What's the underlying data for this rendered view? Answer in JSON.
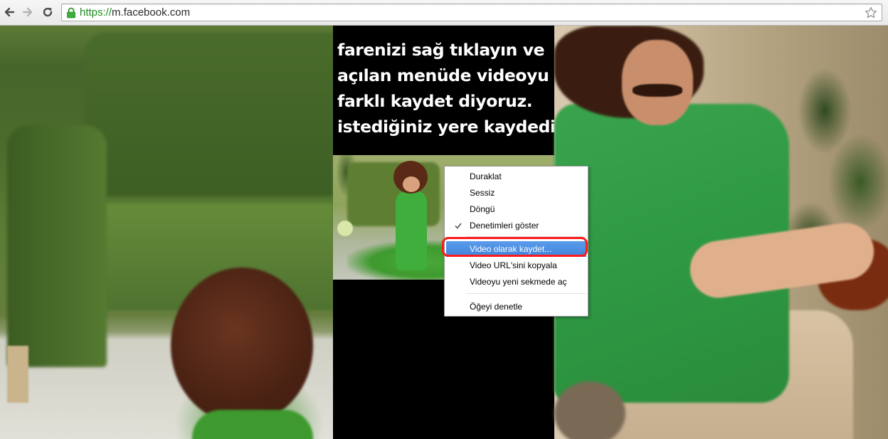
{
  "browser": {
    "url_scheme": "https://",
    "url_host": "m.facebook.com",
    "back_icon": "back-arrow-icon",
    "forward_icon": "forward-arrow-icon",
    "reload_icon": "reload-icon",
    "lock_icon": "lock-icon",
    "bookmark_icon": "star-icon",
    "secure_color": "#1c8c1c"
  },
  "page": {
    "caption_lines": [
      "farenizi sağ tıklayın ve",
      "açılan menüde videoyu",
      "farklı kaydet diyoruz.",
      "istediğiniz yere kaydedin"
    ]
  },
  "context_menu": {
    "items": [
      {
        "label": "Duraklat",
        "checked": false,
        "highlighted": false
      },
      {
        "label": "Sessiz",
        "checked": false,
        "highlighted": false
      },
      {
        "label": "Döngü",
        "checked": false,
        "highlighted": false
      },
      {
        "label": "Denetimleri göster",
        "checked": true,
        "highlighted": false
      },
      {
        "label": "Video olarak kaydet...",
        "checked": false,
        "highlighted": true
      },
      {
        "label": "Video URL'sini kopyala",
        "checked": false,
        "highlighted": false
      },
      {
        "label": "Videoyu yeni sekmede aç",
        "checked": false,
        "highlighted": false
      },
      {
        "label": "Öğeyi denetle",
        "checked": false,
        "highlighted": false
      }
    ],
    "highlight_color": "#4a90e2",
    "annotation_color": "#ff1a1a"
  }
}
